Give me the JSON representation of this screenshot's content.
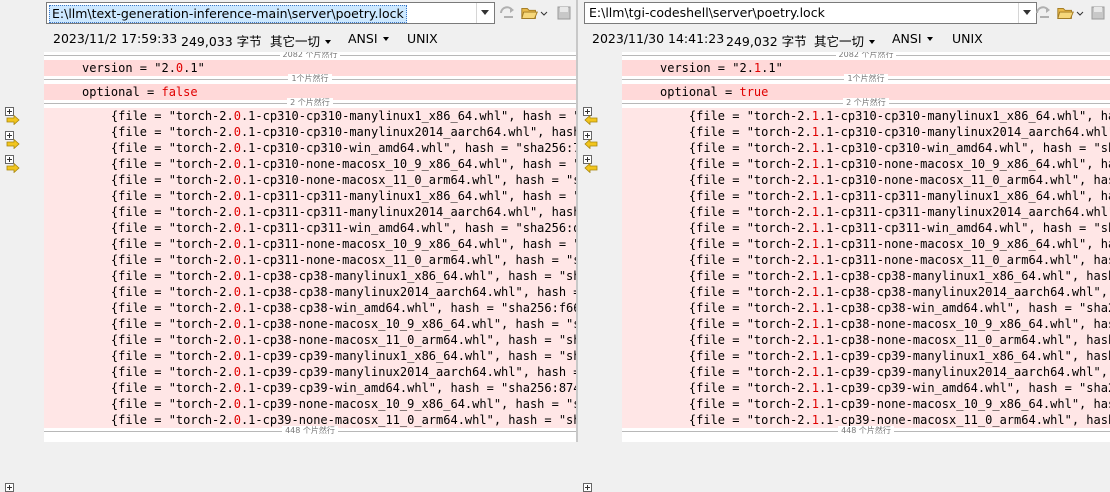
{
  "left": {
    "path": "E:\\llm\\text-generation-inference-main\\server\\poetry.lock",
    "date": "2023/11/2 17:59:33",
    "size": "249,033 字节",
    "filter": "其它一切",
    "encoding": "ANSI",
    "eol": "UNIX",
    "folds": [
      "2082 个片然行",
      "1个片然行",
      "2 个片然行",
      "448 个片然行"
    ],
    "version_pre": "version = \"2.",
    "version_diff": "0",
    "version_post": ".1\"",
    "optional_pre": "optional = ",
    "optional_val": "false",
    "wheels": [
      "{file = \"torch-2.|0|.1-cp310-cp310-manylinux1_x86_64.whl\", hash = \"",
      "{file = \"torch-2.|0|.1-cp310-cp310-manylinux2014_aarch64.whl\", hash",
      "{file = \"torch-2.|0|.1-cp310-cp310-win_amd64.whl\", hash = \"sha256:7",
      "{file = \"torch-2.|0|.1-cp310-none-macosx_10_9_x86_64.whl\", hash = \"",
      "{file = \"torch-2.|0|.1-cp310-none-macosx_11_0_arm64.whl\", hash = \"s",
      "{file = \"torch-2.|0|.1-cp311-cp311-manylinux1_x86_64.whl\", hash = \"",
      "{file = \"torch-2.|0|.1-cp311-cp311-manylinux2014_aarch64.whl\", hash",
      "{file = \"torch-2.|0|.1-cp311-cp311-win_amd64.whl\", hash = \"sha256:d",
      "{file = \"torch-2.|0|.1-cp311-none-macosx_10_9_x86_64.whl\", hash = \"",
      "{file = \"torch-2.|0|.1-cp311-none-macosx_11_0_arm64.whl\", hash = \"s",
      "{file = \"torch-2.|0|.1-cp38-cp38-manylinux1_x86_64.whl\", hash = \"sh",
      "{file = \"torch-2.|0|.1-cp38-cp38-manylinux2014_aarch64.whl\", hash = \"",
      "{file = \"torch-2.|0|.1-cp38-cp38-win_amd64.whl\", hash = \"sha256:f66",
      "{file = \"torch-2.|0|.1-cp38-none-macosx_10_9_x86_64.whl\", hash = \"s",
      "{file = \"torch-2.|0|.1-cp38-none-macosx_11_0_arm64.whl\", hash = \"sh",
      "{file = \"torch-2.|0|.1-cp39-cp39-manylinux1_x86_64.whl\", hash = \"sh",
      "{file = \"torch-2.|0|.1-cp39-cp39-manylinux2014_aarch64.whl\", hash = \"",
      "{file = \"torch-2.|0|.1-cp39-cp39-win_amd64.whl\", hash = \"sha256:874",
      "{file = \"torch-2.|0|.1-cp39-none-macosx_10_9_x86_64.whl\", hash = \"s",
      "{file = \"torch-2.|0|.1-cp39-none-macosx_11_0_arm64.whl\", hash = \"sh"
    ]
  },
  "right": {
    "path": "E:\\llm\\tgi-codeshell\\server\\poetry.lock",
    "date": "2023/11/30 14:41:23",
    "size": "249,032 字节",
    "filter": "其它一切",
    "encoding": "ANSI",
    "eol": "UNIX",
    "folds": [
      "2082 个片然行",
      "1个片然行",
      "2 个片然行",
      "448 个片然行"
    ],
    "version_pre": "version = \"2.",
    "version_diff": "1",
    "version_post": ".1\"",
    "optional_pre": "optional = ",
    "optional_val": "true",
    "wheels": [
      "{file = \"torch-2.|1|.1-cp310-cp310-manylinux1_x86_64.whl\", hash = \"",
      "{file = \"torch-2.|1|.1-cp310-cp310-manylinux2014_aarch64.whl\", hash =",
      "{file = \"torch-2.|1|.1-cp310-cp310-win_amd64.whl\", hash = \"sha256:0",
      "{file = \"torch-2.|1|.1-cp310-none-macosx_10_9_x86_64.whl\", hash = \"",
      "{file = \"torch-2.|1|.1-cp310-none-macosx_11_0_arm64.whl\", hash = \"s",
      "{file = \"torch-2.|1|.1-cp311-cp311-manylinux1_x86_64.whl\", hash = \"",
      "{file = \"torch-2.|1|.1-cp311-cp311-manylinux2014_aarch64.whl\", hash",
      "{file = \"torch-2.|1|.1-cp311-cp311-win_amd64.whl\", hash = \"sha256:1",
      "{file = \"torch-2.|1|.1-cp311-none-macosx_10_9_x86_64.whl\", hash = \"",
      "{file = \"torch-2.|1|.1-cp311-none-macosx_11_0_arm64.whl\", hash = \"s",
      "{file = \"torch-2.|1|.1-cp38-cp38-manylinux1_x86_64.whl\", hash = \"sh",
      "{file = \"torch-2.|1|.1-cp38-cp38-manylinux2014_aarch64.whl\", hash = \"",
      "{file = \"torch-2.|1|.1-cp38-cp38-win_amd64.whl\", hash = \"sha256:2dc",
      "{file = \"torch-2.|1|.1-cp38-none-macosx_10_9_x86_64.whl\", hash = \"s",
      "{file = \"torch-2.|1|.1-cp38-none-macosx_11_0_arm64.whl\", hash = \"sh",
      "{file = \"torch-2.|1|.1-cp39-cp39-manylinux1_x86_64.whl\", hash = \"sh",
      "{file = \"torch-2.|1|.1-cp39-cp39-manylinux2014_aarch64.whl\", hash = \"",
      "{file = \"torch-2.|1|.1-cp39-cp39-win_amd64.whl\", hash = \"sha256:403",
      "{file = \"torch-2.|1|.1-cp39-none-macosx_10_9_x86_64.whl\", hash = \"s",
      "{file = \"torch-2.|1|.1-cp39-none-macosx_11_0_arm64.whl\", hash = \"sh"
    ]
  },
  "colors": {
    "diff": "#e00000",
    "line_bg": "#ffe6e6",
    "arrow": "#f2c51d"
  },
  "icons": [
    "dropdown-icon",
    "copy-arrow-icon",
    "folder-open-icon",
    "save-icon",
    "expand-fold-icon",
    "diff-arrow-icon"
  ]
}
